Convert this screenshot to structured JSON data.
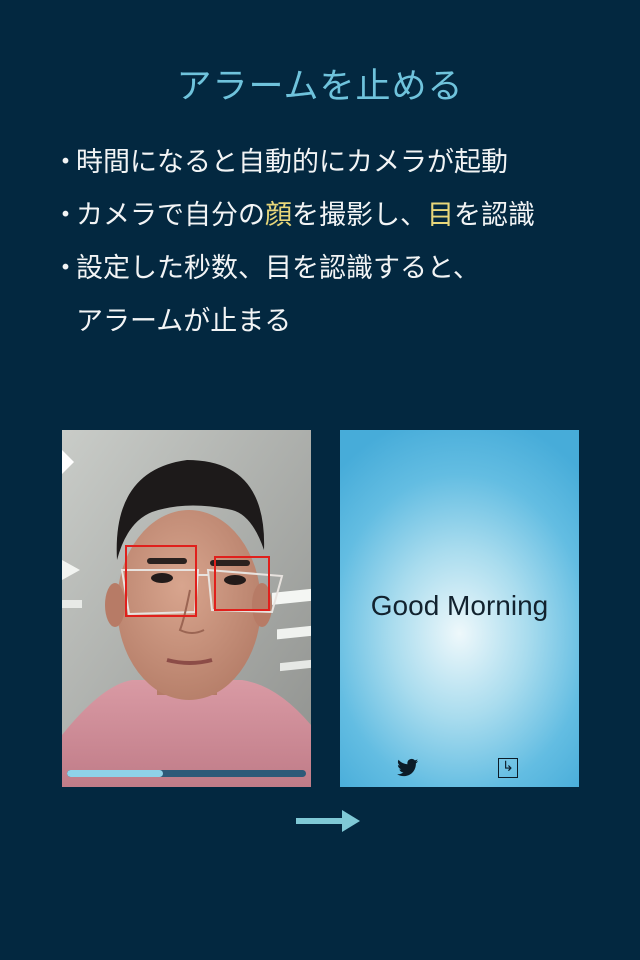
{
  "title": "アラームを止める",
  "bullets": [
    {
      "marker": "・",
      "parts": [
        "時間になると自動的にカメラが起動"
      ]
    },
    {
      "marker": "・",
      "parts": [
        "カメラで自分の",
        "顔",
        "を撮影し、",
        "目",
        "を認識"
      ]
    },
    {
      "marker": "・",
      "parts": [
        "設定した秒数、目を認識すると、"
      ]
    },
    {
      "marker": "",
      "parts": [
        "アラームが止まる"
      ]
    }
  ],
  "camera": {
    "progress_fraction": 0.4,
    "box_color": "#e0201c"
  },
  "alarm_screen": {
    "greeting": "Good Morning",
    "icons": [
      "twitter-icon",
      "exit-icon"
    ]
  },
  "colors": {
    "background": "#032840",
    "title": "#6fc3dc",
    "highlight": "#e8d77a",
    "text": "#f2f4f5"
  }
}
